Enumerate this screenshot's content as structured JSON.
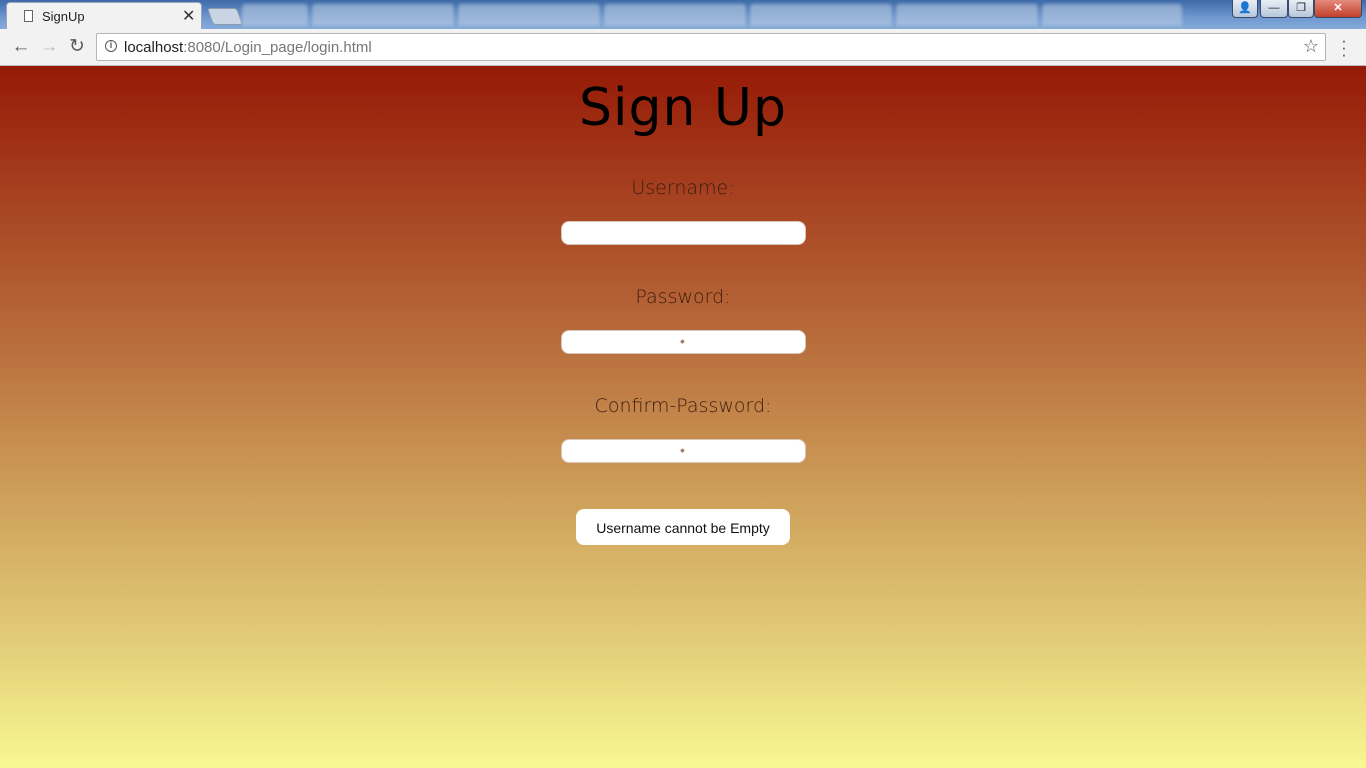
{
  "browser": {
    "active_tab_title": "SignUp",
    "close_glyph": "✕",
    "url_host": "localhost",
    "url_rest": ":8080/Login_page/login.html",
    "nav": {
      "back": "←",
      "forward": "→",
      "reload": "↻"
    },
    "star_glyph": "☆",
    "menu_glyph": "⋮",
    "window_controls": {
      "user": "👤",
      "minimize": "—",
      "restore": "❐",
      "close": "✕"
    },
    "background_tabs": [
      "",
      "",
      "",
      "",
      "",
      "",
      ""
    ]
  },
  "page": {
    "heading": "Sign Up",
    "username_label": "Username:",
    "username_value": "",
    "password_label": "Password:",
    "password_value": "•",
    "confirm_label": "Confirm-Password:",
    "confirm_value": "•",
    "message_button": "Username cannot be Empty"
  },
  "colors": {
    "gradient_top": "#961a07",
    "gradient_bottom": "#f8f892"
  }
}
